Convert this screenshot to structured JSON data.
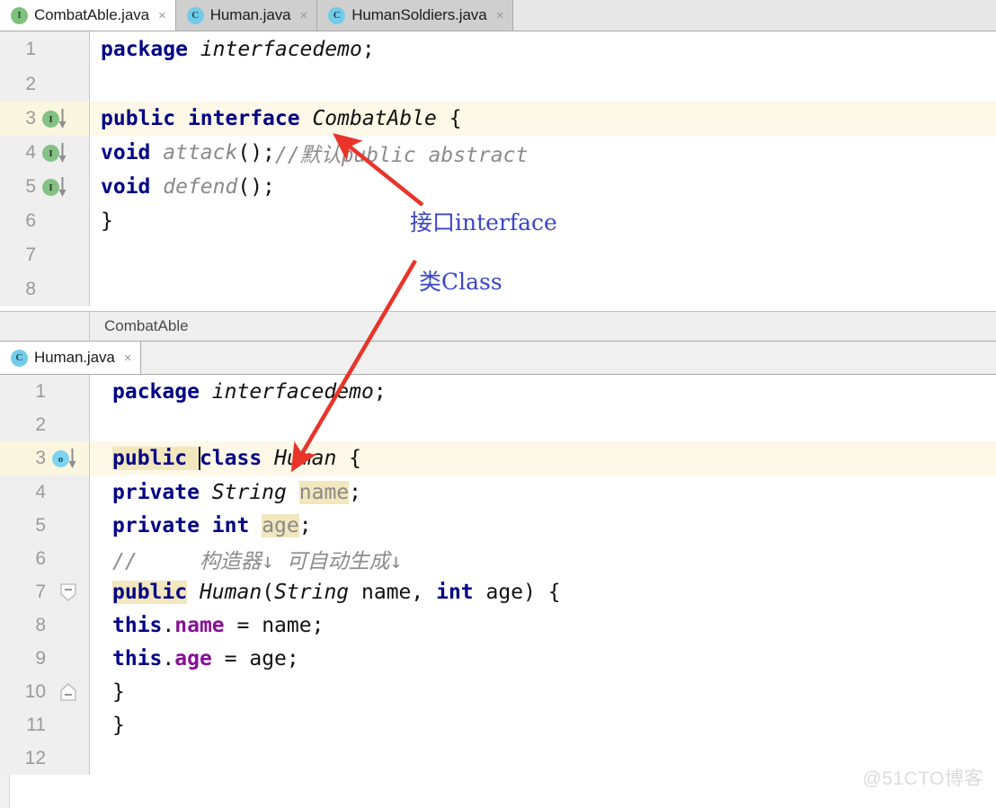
{
  "window": {
    "app": "IntelliJ IDEA editor",
    "watermark": "@51CTO博客"
  },
  "colors": {
    "keyword": "#000086",
    "field": "#871094",
    "comment": "#8c8c8c",
    "highlight": "#f2e7bd",
    "caret_line": "#fdf8e7",
    "annotation_text": "#3b45c8",
    "annotation_arrow": "#e8342a",
    "interface_icon": "#85c185",
    "class_icon": "#7fd3ef"
  },
  "top_tabbar": {
    "tabs": [
      {
        "label": "CombatAble.java",
        "icon": "interface-file-icon",
        "icon_letter": "I",
        "active": true,
        "close": "×"
      },
      {
        "label": "Human.java",
        "icon": "class-file-icon",
        "icon_letter": "C",
        "active": false,
        "close": "×"
      },
      {
        "label": "HumanSoldiers.java",
        "icon": "class-file-icon",
        "icon_letter": "C",
        "active": false,
        "close": "×"
      }
    ]
  },
  "editor_top": {
    "lines": [
      {
        "num": "1",
        "marker": null,
        "fold": null
      },
      {
        "num": "2",
        "marker": null,
        "fold": null
      },
      {
        "num": "3",
        "marker": "green-i-implemented-icon",
        "marker_letter": "I",
        "caret": true
      },
      {
        "num": "4",
        "marker": "green-i-implemented-icon",
        "marker_letter": "I"
      },
      {
        "num": "5",
        "marker": "green-i-implemented-icon",
        "marker_letter": "I"
      },
      {
        "num": "6",
        "marker": null
      },
      {
        "num": "7",
        "marker": null
      },
      {
        "num": "8",
        "marker": null
      }
    ],
    "code": {
      "l1": {
        "kw": "package",
        "name": " interfacedemo",
        "end": ";"
      },
      "l3": {
        "kw1": "public",
        "kw2": "interface",
        "name": "CombatAble",
        "brace": "{"
      },
      "l4": {
        "kw": "void",
        "meth": "attack",
        "parens": "();",
        "comment": "//默认public abstract"
      },
      "l5": {
        "kw": "void",
        "meth": "defend",
        "parens": "();"
      },
      "l6": {
        "brace": "}"
      }
    },
    "breadcrumb": "CombatAble"
  },
  "second_tabbar": {
    "tabs": [
      {
        "label": "Human.java",
        "icon": "class-file-icon",
        "icon_letter": "C",
        "active": true,
        "close": "×"
      }
    ]
  },
  "editor_bottom": {
    "lines": [
      {
        "num": "1"
      },
      {
        "num": "2"
      },
      {
        "num": "3",
        "marker": "cyan-o-overridden-icon",
        "marker_letter": "o",
        "caret": true
      },
      {
        "num": "4"
      },
      {
        "num": "5"
      },
      {
        "num": "6"
      },
      {
        "num": "7",
        "fold": "fold-collapse-down-icon"
      },
      {
        "num": "8"
      },
      {
        "num": "9"
      },
      {
        "num": "10",
        "fold": "fold-collapse-up-icon"
      },
      {
        "num": "11"
      },
      {
        "num": "12"
      }
    ],
    "code": {
      "l1": {
        "kw": "package",
        "name": " interfacedemo",
        "end": ";"
      },
      "l3": {
        "kw1": "public",
        "kw2": "class",
        "name": "Human",
        "brace": "{"
      },
      "l4": {
        "kw1": "private",
        "type": "String",
        "field": "name",
        "end": ";"
      },
      "l5": {
        "kw1": "private",
        "kw2": "int",
        "field": "age",
        "end": ";"
      },
      "l6": {
        "comment": "//     构造器↓ 可自动生成↓"
      },
      "l7": {
        "kw": "public",
        "ctor": "Human",
        "p1type": "String",
        "p1": "name",
        "sep": ", ",
        "p2type": "int",
        "p2": "age",
        "tail": ") {"
      },
      "l8": {
        "kw": "this",
        "dot": ".",
        "field": "name",
        "assign": " = ",
        "val": "name;"
      },
      "l9": {
        "kw": "this",
        "dot": ".",
        "field": "age",
        "assign": " = ",
        "val": "age;"
      },
      "l10": {
        "brace": "}"
      },
      "l11": {
        "brace": "}"
      }
    }
  },
  "annotations": [
    {
      "text": "接口interface",
      "target": "interface-keyword"
    },
    {
      "text": "类Class",
      "target": "class-keyword"
    }
  ]
}
